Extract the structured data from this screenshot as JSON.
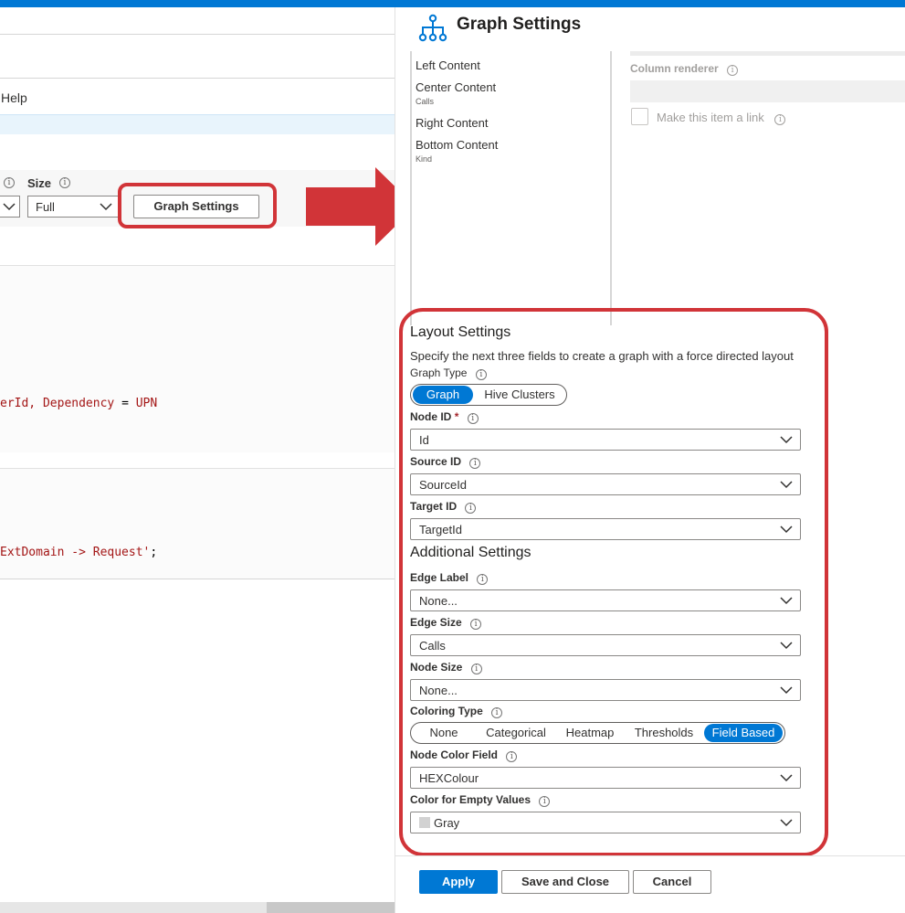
{
  "left": {
    "help_label": "Help",
    "size_label": "Size",
    "size_value": "Full",
    "graph_settings_button": "Graph Settings",
    "code_line_1_prefix": "erId, Dependency ",
    "code_line_1_op": "=",
    "code_line_1_suffix": " UPN",
    "code_line_2_prefix": "ExtDomain -> Request'",
    "code_line_2_op": ";"
  },
  "panel": {
    "title": "Graph Settings",
    "title_icon": "hierarchy-icon",
    "content_items": [
      {
        "label": "Left Content",
        "sub": ""
      },
      {
        "label": "Center Content",
        "sub": "Calls"
      },
      {
        "label": "Right Content",
        "sub": ""
      },
      {
        "label": "Bottom Content",
        "sub": "Kind"
      }
    ],
    "column_renderer_label": "Column renderer",
    "make_link_label": "Make this item a link",
    "layout_settings_title": "Layout Settings",
    "layout_description": "Specify the next three fields to create a graph with a force directed layout",
    "graph_type_label": "Graph Type",
    "graph_type_options": [
      "Graph",
      "Hive Clusters"
    ],
    "graph_type_selected": "Graph",
    "node_id_label": "Node ID",
    "node_id_required": "*",
    "node_id_value": "Id",
    "source_id_label": "Source ID",
    "source_id_value": "SourceId",
    "target_id_label": "Target ID",
    "target_id_value": "TargetId",
    "additional_settings_title": "Additional Settings",
    "edge_label_label": "Edge Label",
    "edge_label_value": "None...",
    "edge_size_label": "Edge Size",
    "edge_size_value": "Calls",
    "node_size_label": "Node Size",
    "node_size_value": "None...",
    "coloring_type_label": "Coloring Type",
    "coloring_type_options": [
      "None",
      "Categorical",
      "Heatmap",
      "Thresholds",
      "Field Based"
    ],
    "coloring_type_selected": "Field Based",
    "node_color_field_label": "Node Color Field",
    "node_color_field_value": "HEXColour",
    "empty_color_label": "Color for Empty Values",
    "empty_color_value": "Gray",
    "apply_button": "Apply",
    "save_close_button": "Save and Close",
    "cancel_button": "Cancel"
  },
  "colors": {
    "accent": "#0078d4",
    "highlight": "#d13438",
    "empty_swatch": "#d2d2d2"
  }
}
